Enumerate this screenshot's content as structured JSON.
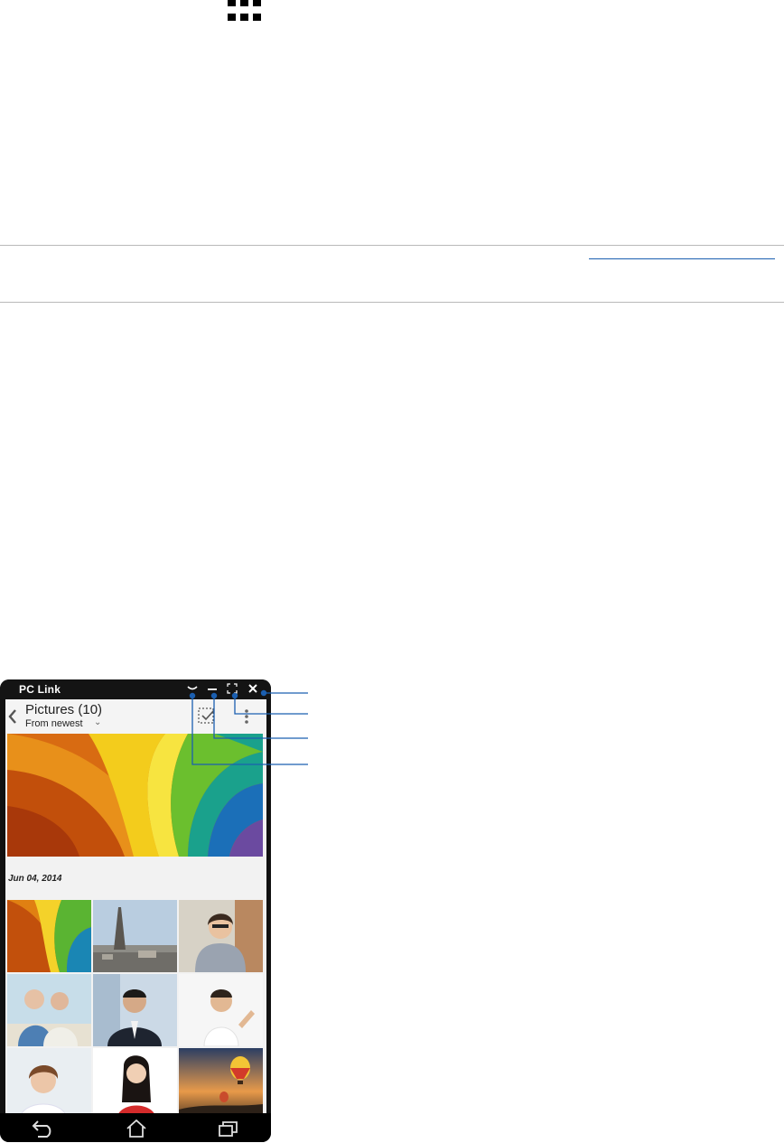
{
  "manual": {
    "apps_icon": "apps-grid-icon"
  },
  "phone": {
    "window_title": "PC Link",
    "controls": [
      {
        "icon": "collapse-icon",
        "glyph": "⌄"
      },
      {
        "icon": "minimize-icon",
        "glyph": "—"
      },
      {
        "icon": "fullscreen-icon",
        "glyph": "⛶"
      },
      {
        "icon": "close-icon",
        "glyph": "✕"
      }
    ],
    "gallery": {
      "title": "Pictures (10)",
      "sort": "From newest",
      "date": "Jun 04,  2014"
    },
    "nav": [
      "back-icon",
      "home-icon",
      "recent-apps-icon"
    ]
  },
  "colors": {
    "callout": "#1b5fb0",
    "titlebar": "#141414"
  }
}
